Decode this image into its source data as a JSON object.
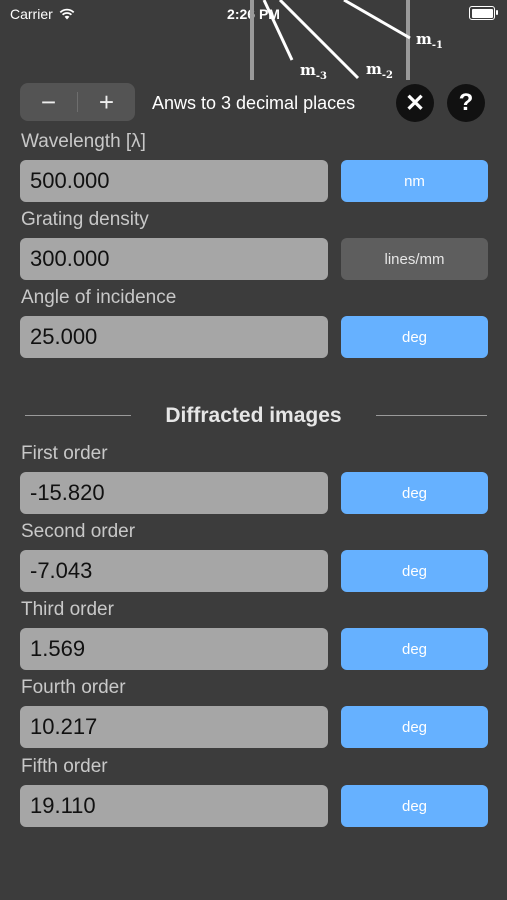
{
  "status": {
    "carrier": "Carrier",
    "time": "2:26 PM"
  },
  "diagram": {
    "labels": {
      "m_minus_1": "m",
      "m_minus_1_sub": "-1",
      "m_minus_2": "m",
      "m_minus_2_sub": "-2",
      "m_minus_3": "m",
      "m_minus_3_sub": "-3"
    }
  },
  "toolbar": {
    "minus": "−",
    "plus": "+",
    "decimals_text": "Anws to 3 decimal places",
    "close": "✕",
    "help": "?"
  },
  "inputs": [
    {
      "label": "Wavelength [λ]",
      "value": "500.000",
      "unit": "nm"
    },
    {
      "label": "Grating density",
      "value": "300.000",
      "unit": "lines/mm"
    },
    {
      "label": "Angle of incidence",
      "value": "25.000",
      "unit": "deg"
    }
  ],
  "section": {
    "title": "Diffracted images"
  },
  "outputs": [
    {
      "label": "First order",
      "value": "-15.820",
      "unit": "deg"
    },
    {
      "label": "Second order",
      "value": "-7.043",
      "unit": "deg"
    },
    {
      "label": "Third order",
      "value": "1.569",
      "unit": "deg"
    },
    {
      "label": "Fourth order",
      "value": "10.217",
      "unit": "deg"
    },
    {
      "label": "Fifth order",
      "value": "19.110",
      "unit": "deg"
    }
  ],
  "colors": {
    "background": "#3c3c3c",
    "accent": "#66b1ff",
    "field": "#a6a6a6",
    "unit_inactive": "#5e5e5e"
  }
}
